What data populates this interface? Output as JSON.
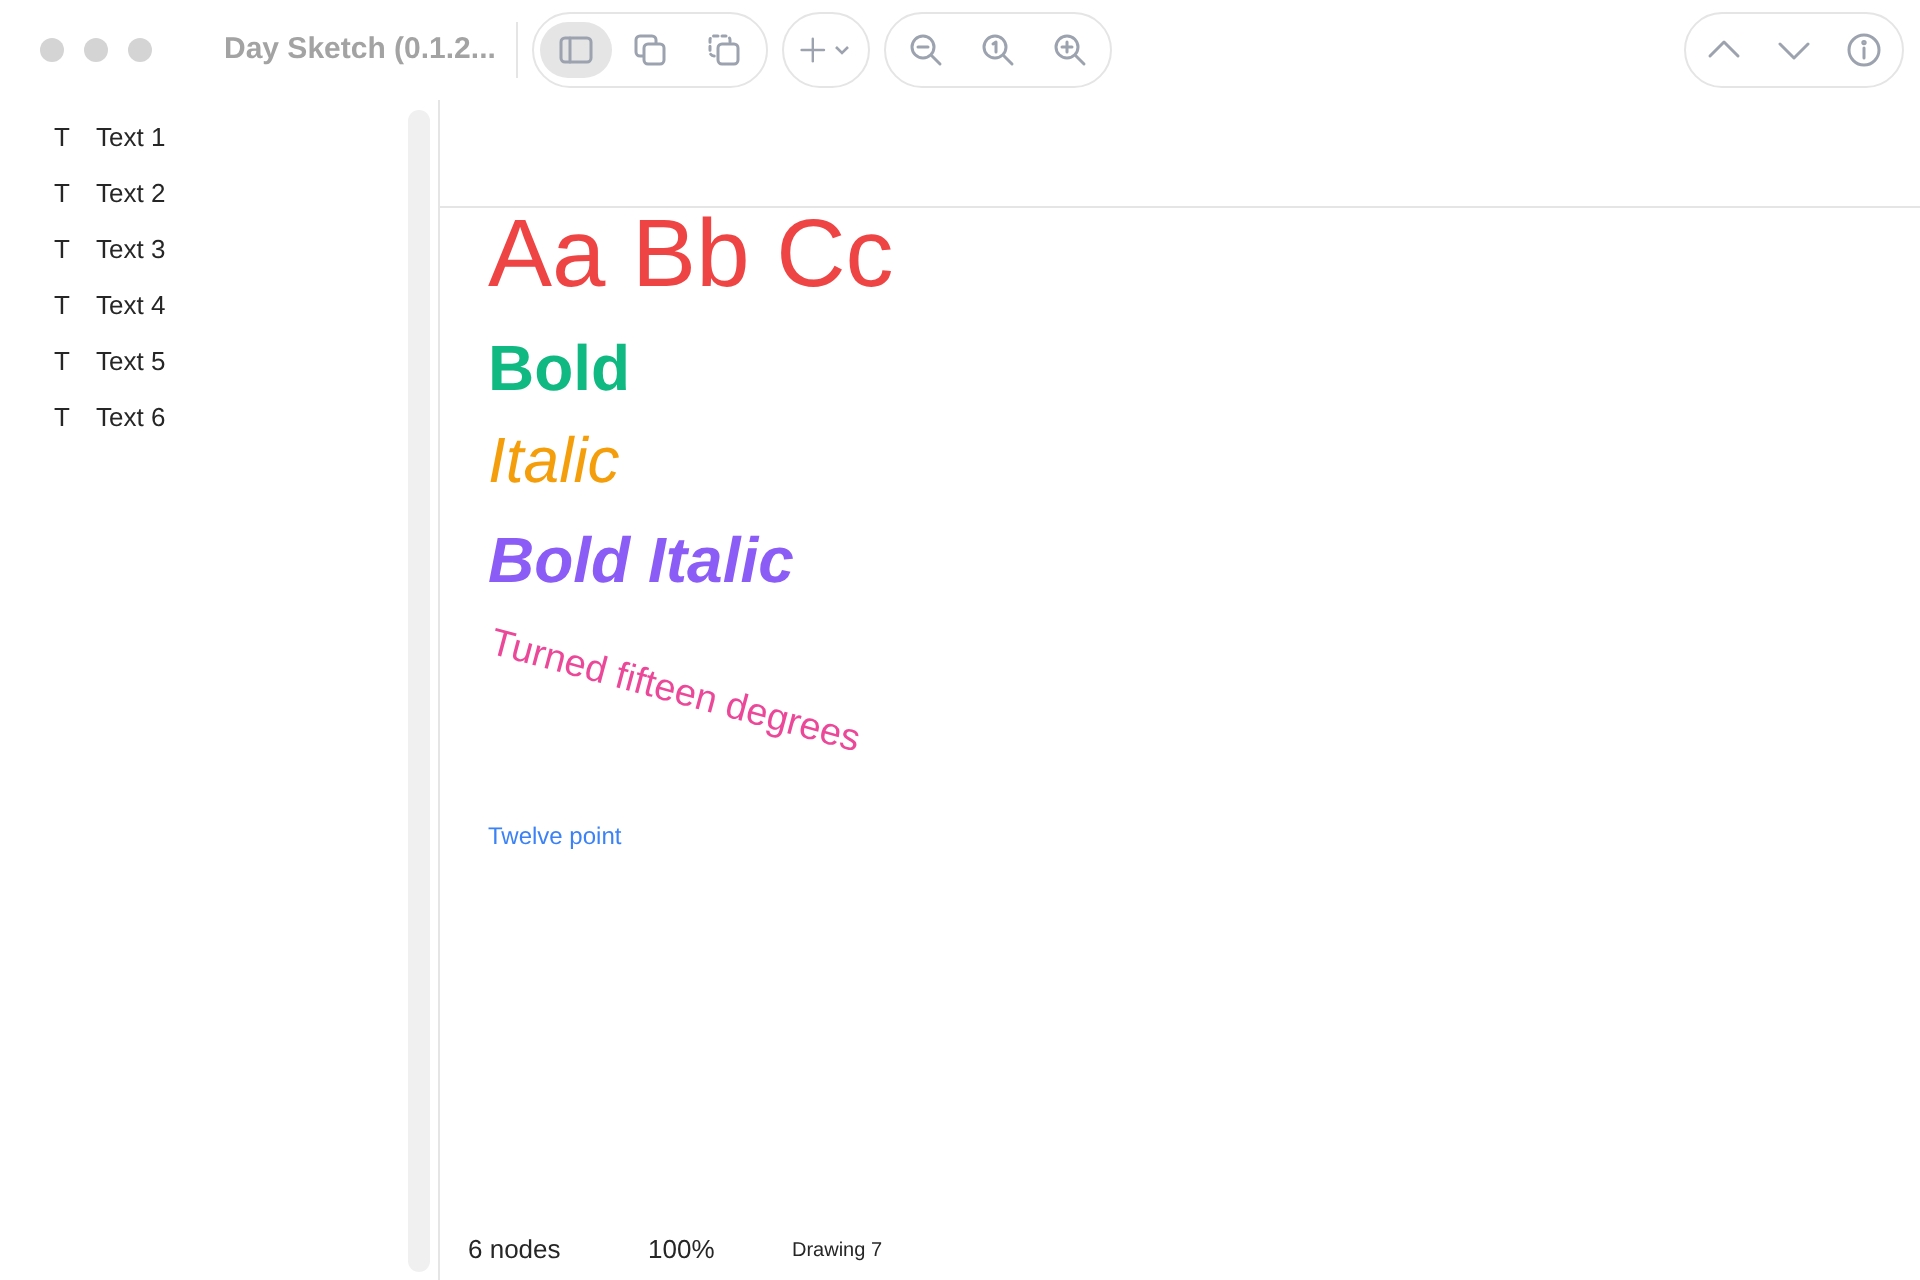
{
  "window": {
    "title": "Day Sketch (0.1.2..."
  },
  "toolbar": {
    "sidebar_toggle_selected": true
  },
  "sidebar": {
    "items": [
      {
        "icon": "T",
        "label": "Text 1"
      },
      {
        "icon": "T",
        "label": "Text 2"
      },
      {
        "icon": "T",
        "label": "Text 3"
      },
      {
        "icon": "T",
        "label": "Text 4"
      },
      {
        "icon": "T",
        "label": "Text 5"
      },
      {
        "icon": "T",
        "label": "Text 6"
      }
    ]
  },
  "canvas": {
    "nodes": [
      {
        "kind": "large",
        "text": "Aa Bb Cc",
        "color": "#ef4444"
      },
      {
        "kind": "bold",
        "text": "Bold",
        "color": "#10b981"
      },
      {
        "kind": "italic",
        "text": "Italic",
        "color": "#f59e0b"
      },
      {
        "kind": "bold_italic",
        "text": "Bold Italic",
        "color": "#8b5cf6"
      },
      {
        "kind": "rotated",
        "text": "Turned fifteen degrees",
        "color": "#ec4899"
      },
      {
        "kind": "small",
        "text": "Twelve point",
        "color": "#3b82f6"
      }
    ]
  },
  "status_bar": {
    "node_count": "6 nodes",
    "zoom": "100%",
    "document": "Drawing 7"
  }
}
